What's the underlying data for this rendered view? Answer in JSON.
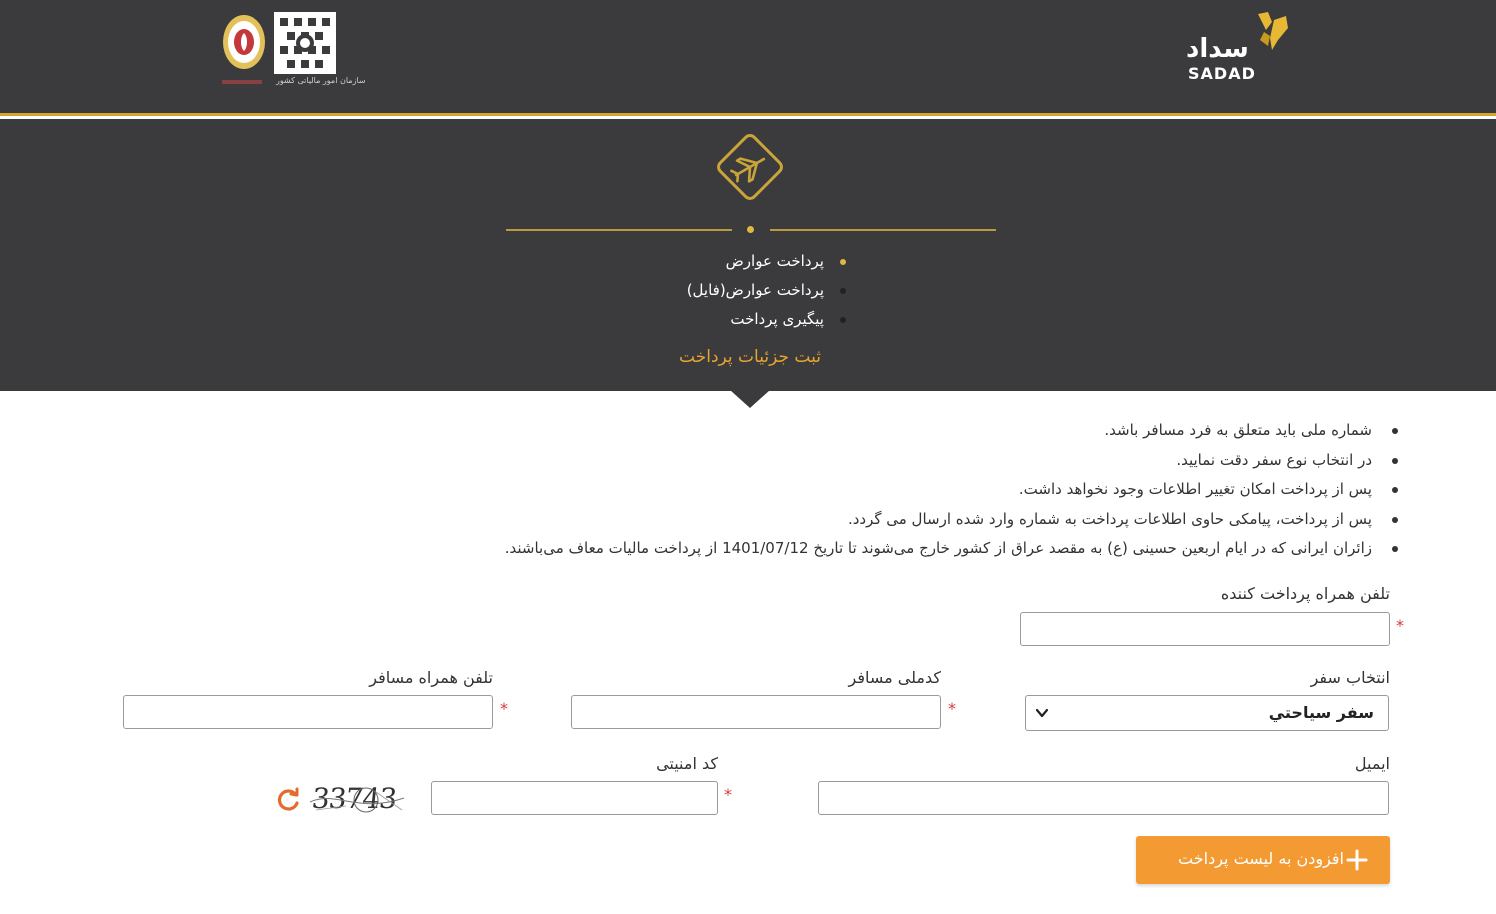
{
  "header": {
    "brand_fa": "سداد",
    "brand_en": "SADAD",
    "partner_caption": "سازمان امور مالیاتی کشور",
    "colors": {
      "bar": "#3b3a3c",
      "accent": "#d4a72c"
    }
  },
  "hero": {
    "icon": "airplane-icon",
    "menu": [
      {
        "label": "پرداخت عوارض",
        "active": true
      },
      {
        "label": "پرداخت عوارض(فایل)",
        "active": false
      },
      {
        "label": "پیگیری پرداخت",
        "active": false
      }
    ],
    "section_title": "ثبت جزئیات پرداخت"
  },
  "notes": [
    "شماره ملی باید متعلق به فرد مسافر باشد.",
    "در انتخاب نوع سفر دقت نمایید.",
    "پس از پرداخت امکان تغییر اطلاعات وجود نخواهد داشت.",
    "پس از پرداخت، پیامکی حاوی اطلاعات پرداخت به شماره وارد شده ارسال می گردد.",
    "زائران ایرانی که در ایام اربعین حسینی (ع) به مقصد عراق از کشور خارج می‌شوند تا تاریخ 1401/07/12 از پرداخت مالیات معاف می‌باشند."
  ],
  "form": {
    "payer_phone": {
      "label": "تلفن همراه پرداخت کننده",
      "value": "",
      "required": "*"
    },
    "trip_type": {
      "label": "انتخاب سفر",
      "selected": "سفر سیاحتي"
    },
    "national_code": {
      "label": "کدملی مسافر",
      "value": "",
      "required": "*"
    },
    "passenger_phone": {
      "label": "تلفن همراه مسافر",
      "value": "",
      "required": "*"
    },
    "email": {
      "label": "ایمیل",
      "value": ""
    },
    "security_code": {
      "label": "کد امنیتی",
      "value": "",
      "required": "*"
    },
    "captcha_text": "33743",
    "submit_label": "افزودن به لیست پرداخت",
    "button_color": "#f39a33"
  }
}
